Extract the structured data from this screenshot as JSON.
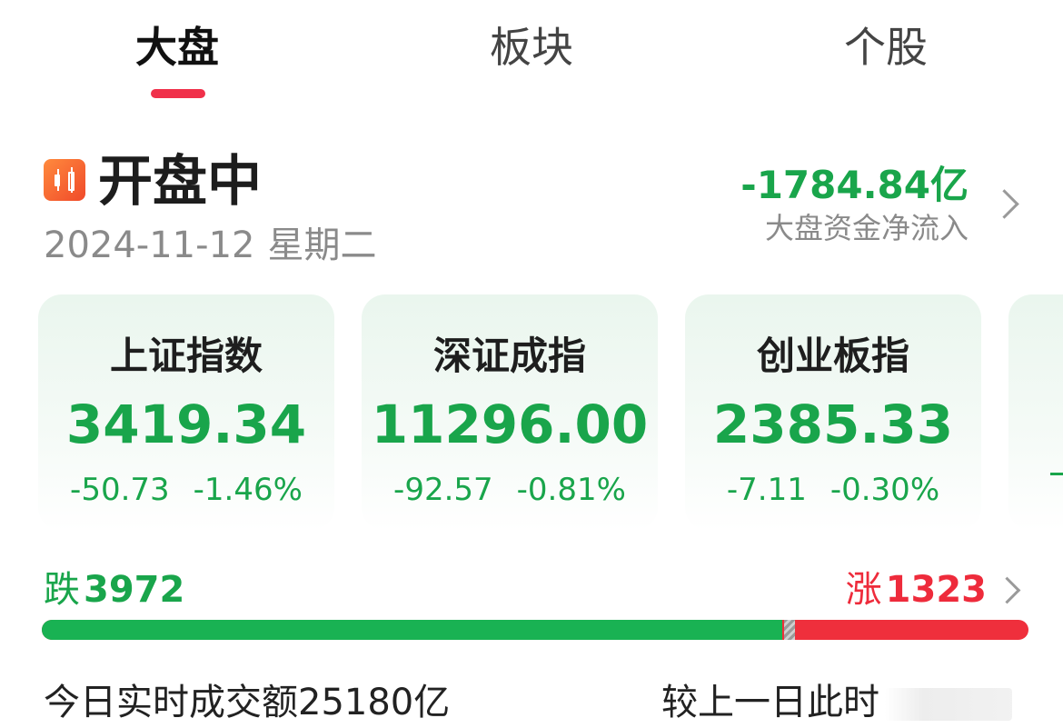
{
  "tabs": [
    {
      "label": "大盘",
      "active": true
    },
    {
      "label": "板块",
      "active": false
    },
    {
      "label": "个股",
      "active": false
    }
  ],
  "header": {
    "status": "开盘中",
    "status_icon": "candlestick-icon",
    "date": "2024-11-12",
    "weekday": "星期二",
    "fund_flow_value": "-1784.84亿",
    "fund_flow_label": "大盘资金净流入"
  },
  "indices": [
    {
      "name": "上证指数",
      "price": "3419.34",
      "change": "-50.73",
      "pct": "-1.46%"
    },
    {
      "name": "深证成指",
      "price": "11296.00",
      "change": "-92.57",
      "pct": "-0.81%"
    },
    {
      "name": "创业板指",
      "price": "2385.33",
      "change": "-7.11",
      "pct": "-0.30%"
    }
  ],
  "breadth": {
    "down_label": "跌",
    "down_count": "3972",
    "up_label": "涨",
    "up_count": "1323",
    "down_fraction": 0.75
  },
  "turnover": {
    "label": "今日实时成交额",
    "value": "25180亿",
    "compare_label": "较上一日此时"
  },
  "colors": {
    "accent": "#f0304a",
    "down": "#19a54b",
    "up": "#ee2b3b",
    "muted": "#8a8a8a"
  }
}
